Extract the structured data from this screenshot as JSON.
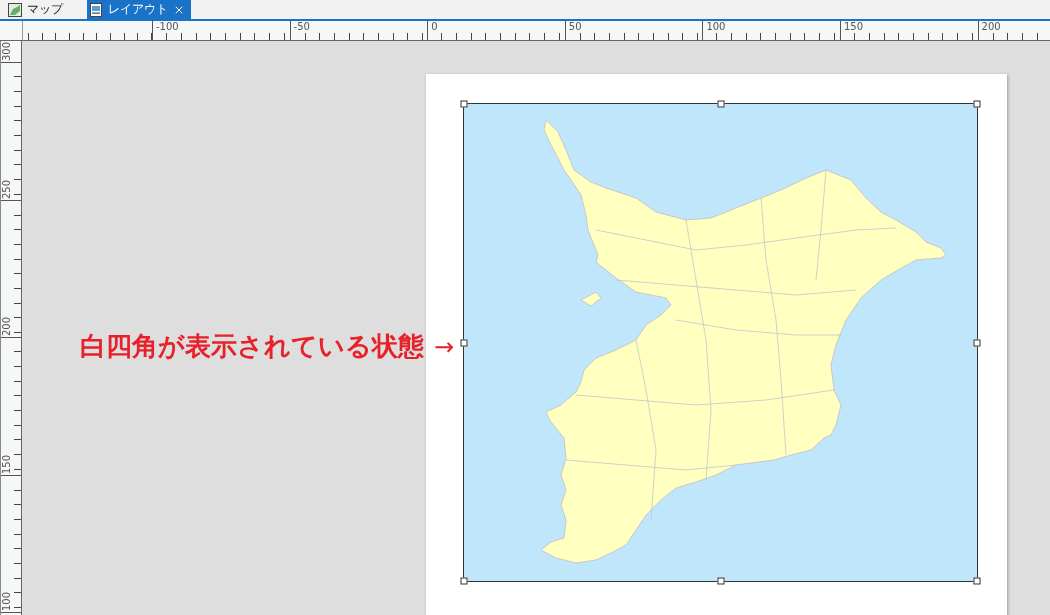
{
  "tabs": [
    {
      "label": "マップ",
      "kind": "map",
      "selected": false,
      "closable": false
    },
    {
      "label": "レイアウト",
      "kind": "layout",
      "selected": true,
      "closable": true
    }
  ],
  "ruler_top": {
    "labels": [
      "-100",
      "-50",
      "0",
      "50",
      "100",
      "150",
      "200"
    ]
  },
  "ruler_left": {
    "labels": [
      "300",
      "250",
      "200",
      "150",
      "100"
    ]
  },
  "annotation": {
    "text": "白四角が表示されている状態",
    "arrow": "→"
  },
  "map_frame": {
    "selected": true
  }
}
